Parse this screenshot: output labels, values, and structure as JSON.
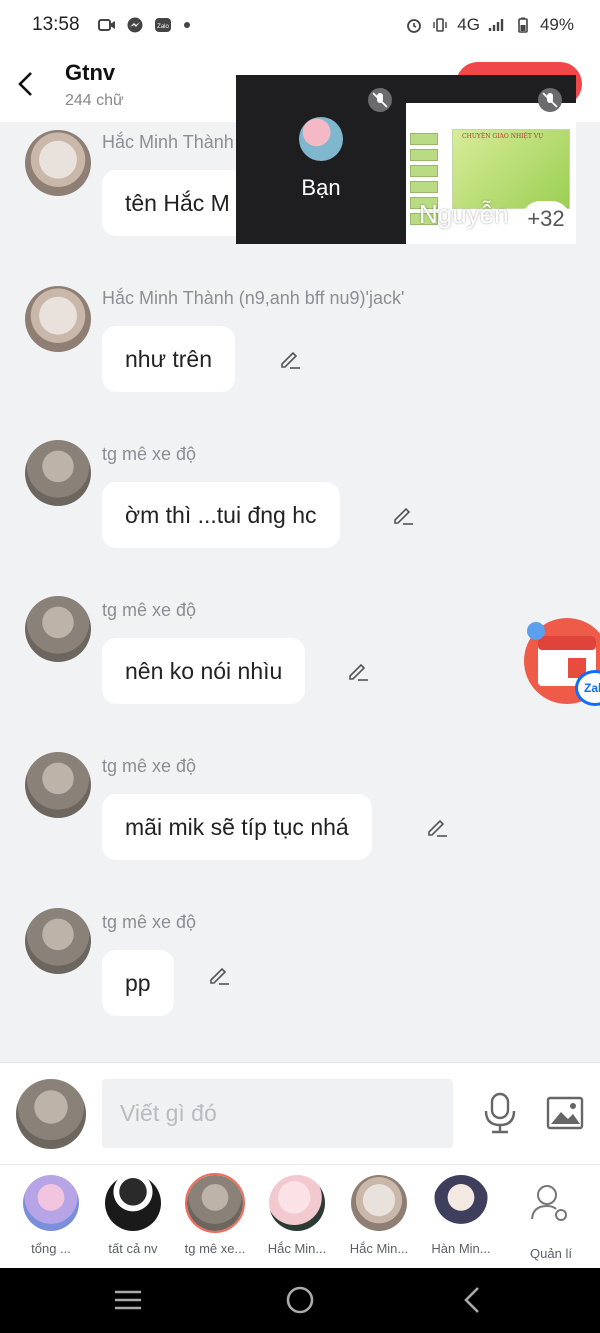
{
  "status_bar": {
    "time": "13:58",
    "network": "4G",
    "battery": "49%"
  },
  "header": {
    "title": "Gtnv",
    "subtitle": "244 chữ"
  },
  "messages": [
    {
      "sender": "Hắc Minh Thành",
      "text": "tên Hắc M"
    },
    {
      "sender": "Hắc Minh Thành (n9,anh bff nu9)'jack'",
      "text": "như trên"
    },
    {
      "sender": "tg mê xe độ",
      "text": "ờm thì ...tui đng hc"
    },
    {
      "sender": "tg mê xe độ",
      "text": "nên ko nói nhìu"
    },
    {
      "sender": "tg mê xe độ",
      "text": "mãi mik sẽ típ tục nhá"
    },
    {
      "sender": "tg mê xe độ",
      "text": "pp"
    }
  ],
  "call": {
    "self_label": "Bạn",
    "remote_label": "Nguyễn",
    "more_count": "+32",
    "slide_title": "CHUYỆN GIAO NHIỆT VỤ"
  },
  "calendar": {
    "badge_day": "1",
    "brand": "Zal"
  },
  "composer": {
    "placeholder": "Viết gì đó"
  },
  "members": [
    {
      "label": "tổng ..."
    },
    {
      "label": "tất cả nv"
    },
    {
      "label": "tg mê xe..."
    },
    {
      "label": "Hắc Min..."
    },
    {
      "label": "Hắc Min..."
    },
    {
      "label": "Hàn Min..."
    },
    {
      "label": "Quản lí"
    }
  ]
}
